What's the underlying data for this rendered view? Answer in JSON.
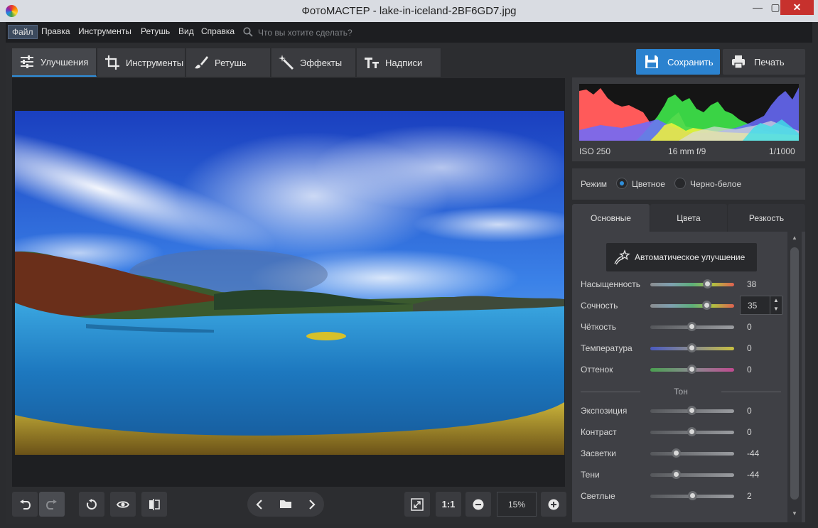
{
  "window": {
    "title": "ФотоМАСТЕР - lake-in-iceland-2BF6GD7.jpg",
    "minimize": "—",
    "maximize": "▢",
    "close": "✕"
  },
  "menu": {
    "items": [
      "Файл",
      "Правка",
      "Инструменты",
      "Ретушь",
      "Вид",
      "Справка"
    ],
    "search_placeholder": "Что вы хотите сделать?"
  },
  "tabs": [
    {
      "label": "Улучшения",
      "icon": "sliders-icon",
      "active": true
    },
    {
      "label": "Инструменты",
      "icon": "crop-icon"
    },
    {
      "label": "Ретушь",
      "icon": "brush-icon"
    },
    {
      "label": "Эффекты",
      "icon": "magic-wand-icon"
    },
    {
      "label": "Надписи",
      "icon": "text-icon"
    }
  ],
  "actions": {
    "save_label": "Сохранить",
    "print_label": "Печать"
  },
  "histogram": {
    "iso": "ISO 250",
    "lens": "16 mm f/9",
    "shutter": "1/1000"
  },
  "mode": {
    "label": "Режим",
    "options": [
      {
        "label": "Цветное",
        "selected": true
      },
      {
        "label": "Черно-белое",
        "selected": false
      }
    ]
  },
  "subtabs": [
    {
      "label": "Основные",
      "active": true
    },
    {
      "label": "Цвета"
    },
    {
      "label": "Резкость"
    }
  ],
  "auto_enhance_label": "Автоматическое улучшение",
  "sliders": [
    {
      "name": "Насыщенность",
      "value": "38",
      "level": 0.67
    },
    {
      "name": "Сочность",
      "value": "35",
      "level": 0.66,
      "spinner": true
    },
    {
      "name": "Чёткость",
      "value": "0",
      "level": 0.5
    },
    {
      "name": "Температура",
      "value": "0",
      "level": 0.5
    },
    {
      "name": "Оттенок",
      "value": "0",
      "level": 0.5
    }
  ],
  "tone_section": "Тон",
  "tone_sliders": [
    {
      "name": "Экспозиция",
      "value": "0",
      "level": 0.5
    },
    {
      "name": "Контраст",
      "value": "0",
      "level": 0.5
    },
    {
      "name": "Засветки",
      "value": "-44",
      "level": 0.31
    },
    {
      "name": "Тени",
      "value": "-44",
      "level": 0.31
    },
    {
      "name": "Светлые",
      "value": "2",
      "level": 0.51
    }
  ],
  "toolbar": {
    "one_to_one": "1:1",
    "zoom": "15%"
  },
  "colors": {
    "accent": "#2b82cf",
    "close": "#c7312d"
  }
}
